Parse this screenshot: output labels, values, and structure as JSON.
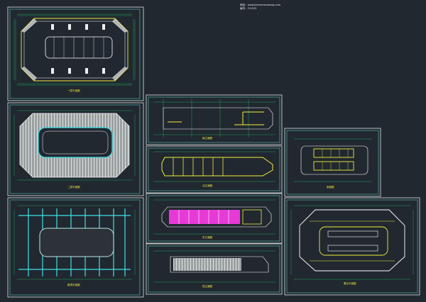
{
  "header": {
    "line1": "网站：www.jianzhuwuwang.com",
    "line2": "编号：P-0023"
  },
  "colors": {
    "background": "#212830",
    "frame": "#dfe7e7",
    "sheet_border": "#5ec7b8",
    "grid": "#1fd36a",
    "wall": "#f1ee3a",
    "structure": "#ffffff",
    "accent_cyan": "#3fe1e8",
    "accent_magenta": "#e63ad7",
    "pitch_outline": "#b8e7e8"
  },
  "sheets": [
    {
      "id": "s1",
      "caption": "一层平面图"
    },
    {
      "id": "s2",
      "caption": "二层平面图"
    },
    {
      "id": "s3",
      "caption": "屋顶平面图"
    },
    {
      "id": "s4",
      "caption": "南立面图"
    },
    {
      "id": "s5",
      "caption": "北立面图"
    },
    {
      "id": "s6",
      "caption": "东立面图"
    },
    {
      "id": "s7",
      "caption": "西立面图"
    },
    {
      "id": "s8",
      "caption": "剖面图"
    },
    {
      "id": "s9",
      "caption": "看台平面图"
    }
  ]
}
